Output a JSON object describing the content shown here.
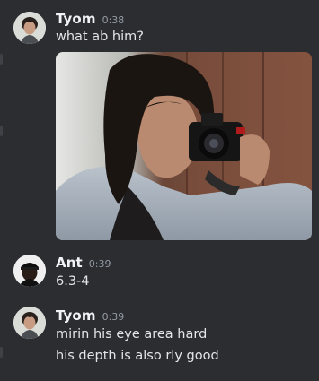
{
  "messages": [
    {
      "author": "Tyom",
      "time": "0:38",
      "lines": [
        "what ab him?"
      ],
      "avatar_icon": "user-avatar-icon",
      "has_image_attachment": true
    },
    {
      "author": "Ant",
      "time": "0:39",
      "lines": [
        "6.3-4"
      ],
      "avatar_icon": "user-avatar-icon"
    },
    {
      "author": "Tyom",
      "time": "0:39",
      "lines": [
        "mirin his eye area hard",
        "his depth is also rly good"
      ],
      "avatar_icon": "user-avatar-icon"
    }
  ],
  "colors": {
    "background": "#2b2d31",
    "username": "#f2f3f5",
    "timestamp": "#949ba4",
    "message_text": "#e3e5e8"
  }
}
